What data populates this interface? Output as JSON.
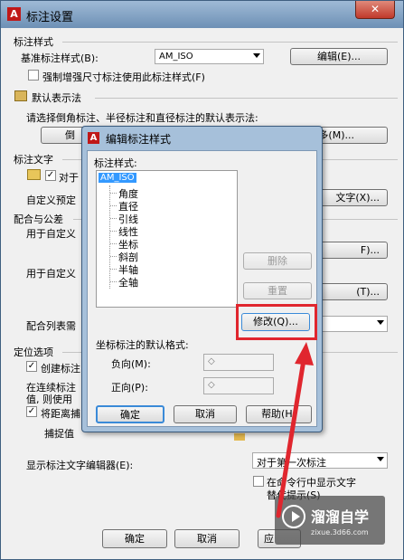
{
  "main": {
    "title": "标注设置",
    "annot_style_header": "标注样式",
    "base_style_label": "基准标注样式(B):",
    "base_style_value": "AM_ISO",
    "edit_button": "编辑(E)...",
    "force_label": "强制增强尺寸标注使用此标注样式(F)",
    "default_header": "默认表示法",
    "default_desc": "请选择倒角标注、半径标注和直径标注的默认表示法:",
    "chamfer_button": "倒",
    "more_button": "多(M)...",
    "text_header": "标注文字",
    "text_check_label": "对于",
    "custom_label": "自定义预定",
    "text_button": "文字(X)...",
    "tolerance_header": "配合与公差",
    "custom1_label": "用于自定义",
    "f_button": "F)...",
    "custom2_label": "用于自定义",
    "t_button": "(T)...",
    "fitlist_label": "配合列表需",
    "position_header": "定位选项",
    "create_label": "创建标注",
    "continuous_label": "在连续标注",
    "continuous_label2": "值, 则使用",
    "distance_label": "将距离捕",
    "capture_label": "捕捉值",
    "show_editor_label": "显示标注文字编辑器(E):",
    "show_editor_value": "对于第一次标注",
    "cmdline_label": "在命令行中显示文字",
    "cmdline_label2": "替代提示(S)",
    "ok_button": "确定",
    "cancel_button": "取消",
    "apply_button": "应"
  },
  "dialog": {
    "title": "编辑标注样式",
    "styles_label": "标注样式:",
    "tree_root": "AM_ISO",
    "tree_children": [
      "角度",
      "直径",
      "引线",
      "线性",
      "坐标",
      "斜剖",
      "半轴",
      "全轴"
    ],
    "delete_button": "删除",
    "reset_button": "重置",
    "modify_button": "修改(Q)...",
    "coord_format_label": "坐标标注的默认格式:",
    "negative_label": "负向(M):",
    "negative_value": "◇",
    "positive_label": "正向(P):",
    "positive_value": "◇",
    "ok_button": "确定",
    "cancel_button": "取消",
    "help_button": "帮助(H)"
  },
  "watermark": {
    "brand": "溜溜自学",
    "url": "zixue.3d66.com"
  },
  "colors": {
    "highlight": "#e0262e",
    "window_bg": "#f0f0f0",
    "titlebar": "#6d90b5"
  }
}
